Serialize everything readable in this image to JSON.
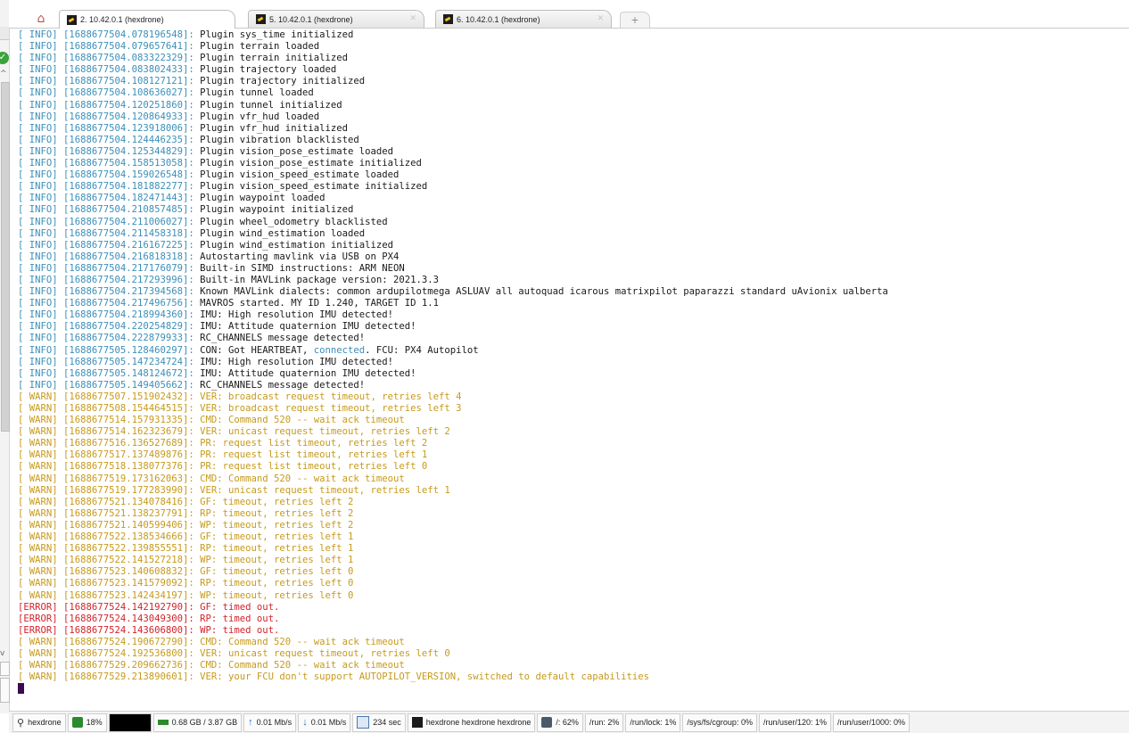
{
  "tabs": [
    {
      "label": "2. 10.42.0.1 (hexdrone)",
      "active": true
    },
    {
      "label": "5. 10.42.0.1 (hexdrone)",
      "active": false
    },
    {
      "label": "6. 10.42.0.1 (hexdrone)",
      "active": false
    }
  ],
  "colors": {
    "info": "#3b8fb8",
    "warn": "#c79a1b",
    "error": "#d2232a",
    "text": "#1a1a1a"
  },
  "log": [
    {
      "level": "INFO",
      "ts": "1688677504.078196548",
      "msg": "Plugin sys_time initialized"
    },
    {
      "level": "INFO",
      "ts": "1688677504.079657641",
      "msg": "Plugin terrain loaded"
    },
    {
      "level": "INFO",
      "ts": "1688677504.083322329",
      "msg": "Plugin terrain initialized"
    },
    {
      "level": "INFO",
      "ts": "1688677504.083802433",
      "msg": "Plugin trajectory loaded"
    },
    {
      "level": "INFO",
      "ts": "1688677504.108127121",
      "msg": "Plugin trajectory initialized"
    },
    {
      "level": "INFO",
      "ts": "1688677504.108636027",
      "msg": "Plugin tunnel loaded"
    },
    {
      "level": "INFO",
      "ts": "1688677504.120251860",
      "msg": "Plugin tunnel initialized"
    },
    {
      "level": "INFO",
      "ts": "1688677504.120864933",
      "msg": "Plugin vfr_hud loaded"
    },
    {
      "level": "INFO",
      "ts": "1688677504.123918006",
      "msg": "Plugin vfr_hud initialized"
    },
    {
      "level": "INFO",
      "ts": "1688677504.124446235",
      "msg": "Plugin vibration blacklisted"
    },
    {
      "level": "INFO",
      "ts": "1688677504.125344829",
      "msg": "Plugin vision_pose_estimate loaded"
    },
    {
      "level": "INFO",
      "ts": "1688677504.158513058",
      "msg": "Plugin vision_pose_estimate initialized"
    },
    {
      "level": "INFO",
      "ts": "1688677504.159026548",
      "msg": "Plugin vision_speed_estimate loaded"
    },
    {
      "level": "INFO",
      "ts": "1688677504.181882277",
      "msg": "Plugin vision_speed_estimate initialized"
    },
    {
      "level": "INFO",
      "ts": "1688677504.182471443",
      "msg": "Plugin waypoint loaded"
    },
    {
      "level": "INFO",
      "ts": "1688677504.210857485",
      "msg": "Plugin waypoint initialized"
    },
    {
      "level": "INFO",
      "ts": "1688677504.211006027",
      "msg": "Plugin wheel_odometry blacklisted"
    },
    {
      "level": "INFO",
      "ts": "1688677504.211458318",
      "msg": "Plugin wind_estimation loaded"
    },
    {
      "level": "INFO",
      "ts": "1688677504.216167225",
      "msg": "Plugin wind_estimation initialized"
    },
    {
      "level": "INFO",
      "ts": "1688677504.216818318",
      "msg": "Autostarting mavlink via USB on PX4"
    },
    {
      "level": "INFO",
      "ts": "1688677504.217176079",
      "msg": "Built-in SIMD instructions: ARM NEON"
    },
    {
      "level": "INFO",
      "ts": "1688677504.217293996",
      "msg": "Built-in MAVLink package version: 2021.3.3"
    },
    {
      "level": "INFO",
      "ts": "1688677504.217394568",
      "msg": "Known MAVLink dialects: common ardupilotmega ASLUAV all autoquad icarous matrixpilot paparazzi standard uAvionix ualberta"
    },
    {
      "level": "INFO",
      "ts": "1688677504.217496756",
      "msg": "MAVROS started. MY ID 1.240, TARGET ID 1.1"
    },
    {
      "level": "INFO",
      "ts": "1688677504.218994360",
      "msg": "IMU: High resolution IMU detected!"
    },
    {
      "level": "INFO",
      "ts": "1688677504.220254829",
      "msg": "IMU: Attitude quaternion IMU detected!"
    },
    {
      "level": "INFO",
      "ts": "1688677504.222879933",
      "msg": "RC_CHANNELS message detected!"
    },
    {
      "level": "INFO",
      "ts": "1688677505.128460297",
      "msg": "CON: Got HEARTBEAT, ",
      "hl": "connected",
      "msg2": ". FCU: PX4 Autopilot"
    },
    {
      "level": "INFO",
      "ts": "1688677505.147234724",
      "msg": "IMU: High resolution IMU detected!"
    },
    {
      "level": "INFO",
      "ts": "1688677505.148124672",
      "msg": "IMU: Attitude quaternion IMU detected!"
    },
    {
      "level": "INFO",
      "ts": "1688677505.149405662",
      "msg": "RC_CHANNELS message detected!"
    },
    {
      "level": "WARN",
      "ts": "1688677507.151902432",
      "msg": "VER: broadcast request timeout, retries left 4"
    },
    {
      "level": "WARN",
      "ts": "1688677508.154464515",
      "msg": "VER: broadcast request timeout, retries left 3"
    },
    {
      "level": "WARN",
      "ts": "1688677514.157931335",
      "msg": "CMD: Command 520 -- wait ack timeout"
    },
    {
      "level": "WARN",
      "ts": "1688677514.162323679",
      "msg": "VER: unicast request timeout, retries left 2"
    },
    {
      "level": "WARN",
      "ts": "1688677516.136527689",
      "msg": "PR: request list timeout, retries left 2"
    },
    {
      "level": "WARN",
      "ts": "1688677517.137489876",
      "msg": "PR: request list timeout, retries left 1"
    },
    {
      "level": "WARN",
      "ts": "1688677518.138077376",
      "msg": "PR: request list timeout, retries left 0"
    },
    {
      "level": "WARN",
      "ts": "1688677519.173162063",
      "msg": "CMD: Command 520 -- wait ack timeout"
    },
    {
      "level": "WARN",
      "ts": "1688677519.177283990",
      "msg": "VER: unicast request timeout, retries left 1"
    },
    {
      "level": "WARN",
      "ts": "1688677521.134078416",
      "msg": "GF: timeout, retries left 2"
    },
    {
      "level": "WARN",
      "ts": "1688677521.138237791",
      "msg": "RP: timeout, retries left 2"
    },
    {
      "level": "WARN",
      "ts": "1688677521.140599406",
      "msg": "WP: timeout, retries left 2"
    },
    {
      "level": "WARN",
      "ts": "1688677522.138534666",
      "msg": "GF: timeout, retries left 1"
    },
    {
      "level": "WARN",
      "ts": "1688677522.139855551",
      "msg": "RP: timeout, retries left 1"
    },
    {
      "level": "WARN",
      "ts": "1688677522.141527218",
      "msg": "WP: timeout, retries left 1"
    },
    {
      "level": "WARN",
      "ts": "1688677523.140608832",
      "msg": "GF: timeout, retries left 0"
    },
    {
      "level": "WARN",
      "ts": "1688677523.141579092",
      "msg": "RP: timeout, retries left 0"
    },
    {
      "level": "WARN",
      "ts": "1688677523.142434197",
      "msg": "WP: timeout, retries left 0"
    },
    {
      "level": "ERROR",
      "ts": "1688677524.142192790",
      "msg": "GF: timed out."
    },
    {
      "level": "ERROR",
      "ts": "1688677524.143049300",
      "msg": "RP: timed out."
    },
    {
      "level": "ERROR",
      "ts": "1688677524.143606800",
      "msg": "WP: timed out."
    },
    {
      "level": "WARN",
      "ts": "1688677524.190672790",
      "msg": "CMD: Command 520 -- wait ack timeout"
    },
    {
      "level": "WARN",
      "ts": "1688677524.192536800",
      "msg": "VER: unicast request timeout, retries left 0"
    },
    {
      "level": "WARN",
      "ts": "1688677529.209662736",
      "msg": "CMD: Command 520 -- wait ack timeout"
    },
    {
      "level": "WARN",
      "ts": "1688677529.213890601",
      "msg": "VER: your FCU don't support AUTOPILOT_VERSION, switched to default capabilities"
    }
  ],
  "status": {
    "user": "hexdrone",
    "cpu": "18%",
    "memory": "0.68 GB / 3.87 GB",
    "upload": "0.01 Mb/s",
    "download": "0.01 Mb/s",
    "uptime": "234 sec",
    "host": "hexdrone hexdrone hexdrone",
    "disks": [
      "/: 62%",
      "/run: 2%",
      "/run/lock: 1%",
      "/sys/fs/cgroup: 0%",
      "/run/user/120: 1%",
      "/run/user/1000: 0%"
    ]
  },
  "icons": {
    "home": "home-icon",
    "terminal": "terminal-tab-icon",
    "new_tab": "plus-icon",
    "user": "user-icon",
    "cpu": "cpu-icon",
    "memory": "memory-icon",
    "upload": "upload-arrow-icon",
    "download": "download-arrow-icon",
    "uptime": "clock-icon",
    "host": "host-icon",
    "disk": "disk-icon"
  }
}
